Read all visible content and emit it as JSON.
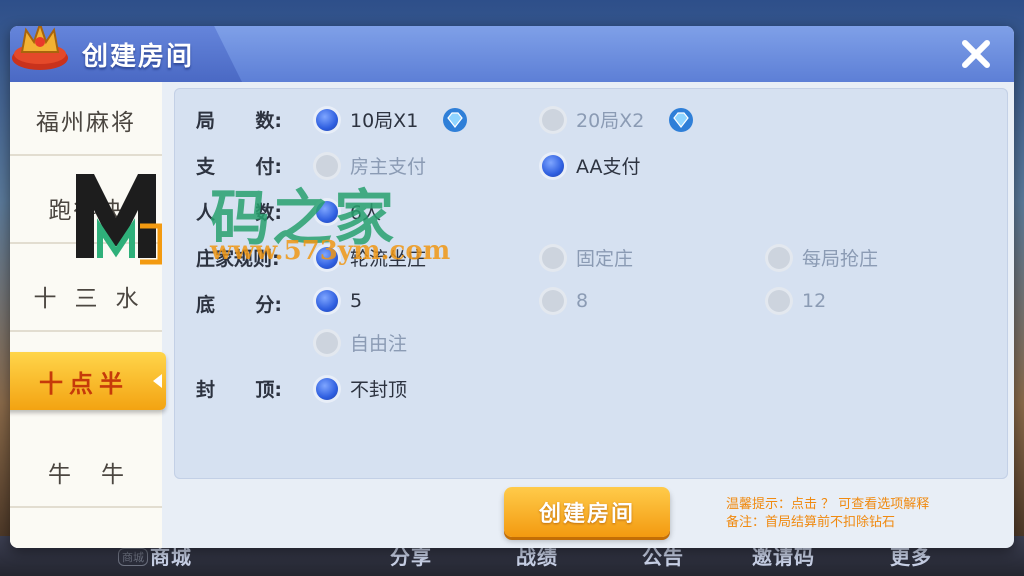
{
  "background_nav": {
    "badge": "商城",
    "items": [
      "商城",
      "分享",
      "战绩",
      "公告",
      "邀请码",
      "更多"
    ]
  },
  "dialog": {
    "title": "创建房间",
    "close_icon": "close-icon"
  },
  "sidebar": {
    "items": [
      {
        "label": "福州麻将",
        "active": false
      },
      {
        "label": "跑得快",
        "active": false
      },
      {
        "label": "十三水",
        "active": false
      },
      {
        "label": "十点半",
        "active": true
      },
      {
        "label": "牛牛",
        "active": false
      }
    ]
  },
  "options": {
    "rounds": {
      "label_a": "局",
      "label_b": "数:",
      "choices": [
        {
          "text": "10局X1",
          "selected": true,
          "icon": "diamond-icon"
        },
        {
          "text": "20局X2",
          "selected": false,
          "icon": "diamond-icon"
        }
      ]
    },
    "payment": {
      "label_a": "支",
      "label_b": "付:",
      "choices": [
        {
          "text": "房主支付",
          "selected": false
        },
        {
          "text": "AA支付",
          "selected": true
        }
      ]
    },
    "players": {
      "label_a": "人",
      "label_b": "数:",
      "choices": [
        {
          "text": "6人",
          "selected": true
        }
      ]
    },
    "banker": {
      "label": "庄家规则:",
      "choices": [
        {
          "text": "轮流坐庄",
          "selected": true
        },
        {
          "text": "固定庄",
          "selected": false
        },
        {
          "text": "每局抢庄",
          "selected": false
        }
      ]
    },
    "base_score": {
      "label_a": "底",
      "label_b": "分:",
      "choices": [
        {
          "text": "5",
          "selected": true
        },
        {
          "text": "8",
          "selected": false
        },
        {
          "text": "12",
          "selected": false
        },
        {
          "text": "自由注",
          "selected": false
        }
      ]
    },
    "cap": {
      "label_a": "封",
      "label_b": "顶:",
      "choices": [
        {
          "text": "不封顶",
          "selected": true
        }
      ]
    }
  },
  "footer": {
    "create_label": "创建房间",
    "tip_line1": "温馨提示：点击 ？ 可查看选项解释",
    "tip_line2": "备注：首局结算前不扣除钻石"
  },
  "watermark": {
    "title": "码之家",
    "url": "www.573ym.com"
  },
  "colors": {
    "header": "#5d7fd6",
    "active_tab": "#f3a312",
    "button": "#f39a10",
    "radio_on": "#2f5fe0"
  }
}
